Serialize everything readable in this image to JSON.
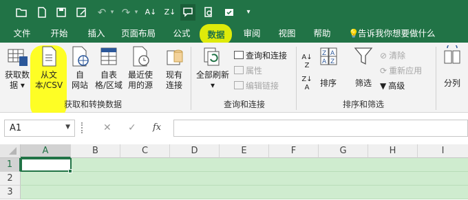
{
  "qat": {
    "more": "▾"
  },
  "tabs": [
    {
      "label": "文件"
    },
    {
      "label": "开始"
    },
    {
      "label": "插入"
    },
    {
      "label": "页面布局"
    },
    {
      "label": "公式"
    },
    {
      "label": "数据"
    },
    {
      "label": "审阅"
    },
    {
      "label": "视图"
    },
    {
      "label": "帮助"
    }
  ],
  "tell_me": "告诉我你想要做什么",
  "ribbon": {
    "get_data": {
      "line1": "获取数",
      "line2": "据 ▾"
    },
    "from_csv": {
      "line1": "从文",
      "line2": "本/CSV"
    },
    "from_web": {
      "line1": "自",
      "line2": "网站"
    },
    "from_table": {
      "line1": "自表",
      "line2": "格/区域"
    },
    "recent": {
      "line1": "最近使",
      "line2": "用的源"
    },
    "existing": {
      "line1": "现有",
      "line2": "连接"
    },
    "group1": "获取和转换数据",
    "refresh_all": {
      "line1": "全部刷新",
      "line2": "▾"
    },
    "queries": "查询和连接",
    "properties": "属性",
    "edit_links": "编辑链接",
    "group2": "查询和连接",
    "sort": "排序",
    "filter": "筛选",
    "clear": "清除",
    "reapply": "重新应用",
    "advanced": "高级",
    "group3": "排序和筛选",
    "split": "分列"
  },
  "formula_bar": {
    "name_box": "A1",
    "fx": "fx",
    "cancel": "✕",
    "enter": "✓"
  },
  "sheet": {
    "columns": [
      "A",
      "B",
      "C",
      "D",
      "E",
      "F",
      "G",
      "H",
      "I"
    ],
    "rows": [
      "1",
      "2",
      "3"
    ]
  },
  "colors": {
    "brand": "#217346",
    "highlight": "#ffff00",
    "selection": "#cfeccf"
  }
}
